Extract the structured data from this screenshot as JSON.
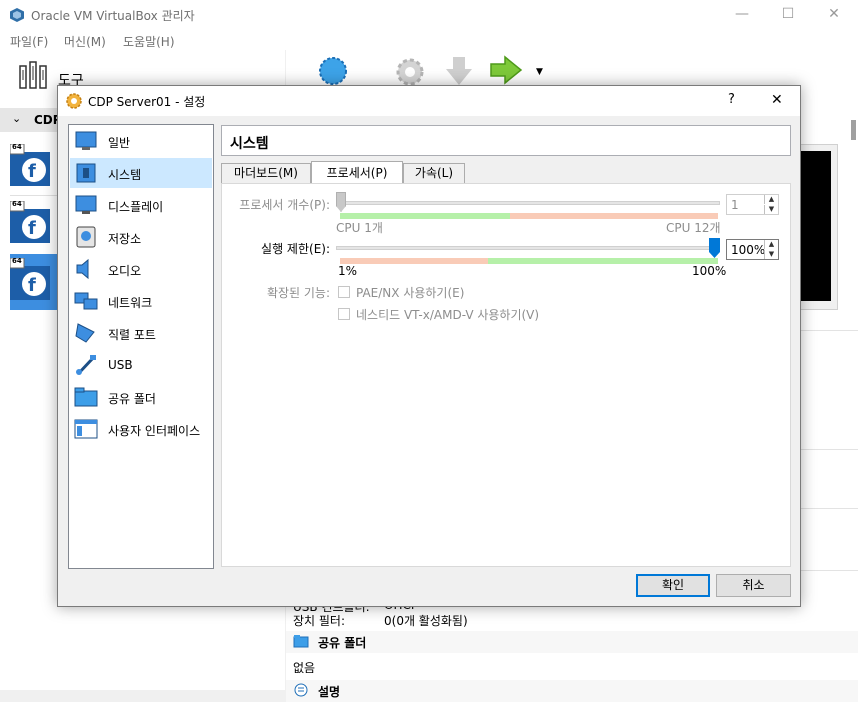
{
  "main": {
    "title": "Oracle VM VirtualBox 관리자",
    "menu": [
      "파일(F)",
      "머신(M)",
      "도움말(H)"
    ],
    "tools_label": "도구",
    "group_label": "CDP",
    "vm_badge": "64",
    "details": {
      "usb_controller_label": "USB 컨트롤러:",
      "usb_controller_value": "OHCI",
      "device_filter_label": "장치 필터:",
      "device_filter_value": "0(0개 활성화됨)",
      "shared_folders_header": "공유 폴더",
      "shared_folders_value": "없음",
      "description_header": "설명"
    }
  },
  "dialog": {
    "title": "CDP Server01 - 설정",
    "help": "?",
    "close": "✕",
    "nav": [
      {
        "label": "일반",
        "icon": "general-icon"
      },
      {
        "label": "시스템",
        "icon": "system-icon"
      },
      {
        "label": "디스플레이",
        "icon": "display-icon"
      },
      {
        "label": "저장소",
        "icon": "storage-icon"
      },
      {
        "label": "오디오",
        "icon": "audio-icon"
      },
      {
        "label": "네트워크",
        "icon": "network-icon"
      },
      {
        "label": "직렬 포트",
        "icon": "serial-port-icon"
      },
      {
        "label": "USB",
        "icon": "usb-icon"
      },
      {
        "label": "공유 폴더",
        "icon": "shared-folder-icon"
      },
      {
        "label": "사용자 인터페이스",
        "icon": "user-interface-icon"
      }
    ],
    "selected_nav": "시스템",
    "page_title": "시스템",
    "tabs": [
      "마더보드(M)",
      "프로세서(P)",
      "가속(L)"
    ],
    "selected_tab": "프로세서(P)",
    "processor": {
      "count_label": "프로세서 개수(P):",
      "count_value": "1",
      "count_min_label": "CPU 1개",
      "count_max_label": "CPU 12개",
      "count_fraction": 0.0,
      "cap_label": "실행 제한(E):",
      "cap_value": "100%",
      "cap_min_label": "1%",
      "cap_max_label": "100%",
      "cap_fraction": 1.0,
      "ext_label": "확장된 기능:",
      "pae_label": "PAE/NX 사용하기(E)",
      "vtx_label": "네스티드 VT-x/AMD-V 사용하기(V)"
    },
    "ok": "확인",
    "cancel": "취소"
  },
  "colors": {
    "selection": "#cce8ff",
    "accent": "#0078d7",
    "zone_green": "#b6f0a9",
    "zone_red": "#f9cbb7"
  }
}
